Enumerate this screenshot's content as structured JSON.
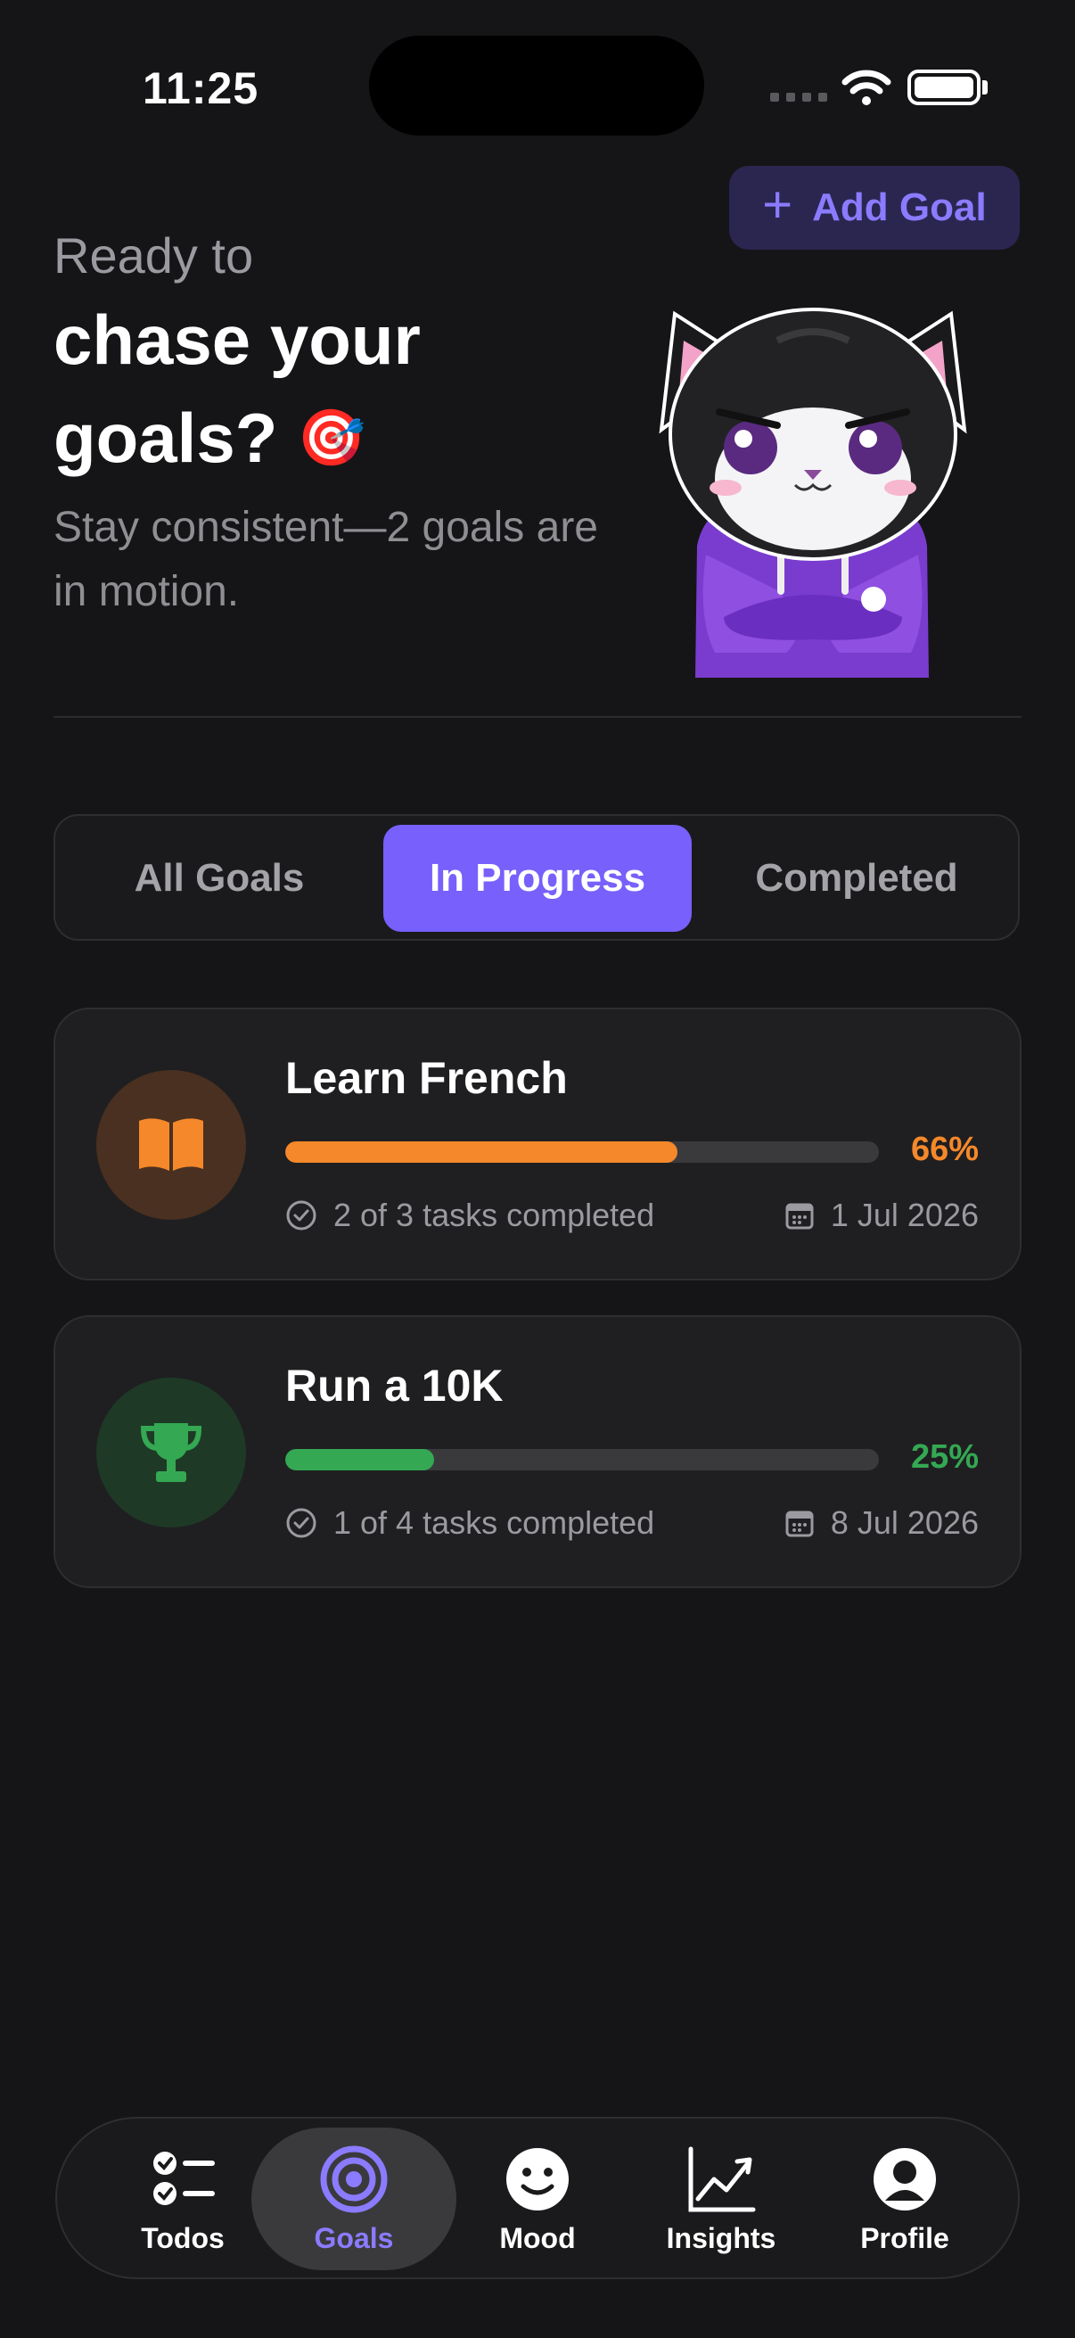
{
  "status_bar": {
    "time": "11:25"
  },
  "header": {
    "add_goal_label": "Add Goal",
    "greeting_line1": "Ready to",
    "greeting_line2": "chase your",
    "greeting_line3": "goals?",
    "greeting_emoji": "🎯",
    "subtitle": "Stay consistent—2 goals are in motion."
  },
  "filter_tabs": {
    "all": "All Goals",
    "in_progress": "In Progress",
    "completed": "Completed",
    "selected": "In Progress"
  },
  "goals": [
    {
      "title": "Learn French",
      "icon": "book-icon",
      "progress": 0.66,
      "percent_label": "66%",
      "tasks_label": "2 of 3 tasks completed",
      "due_date": "1 Jul 2026",
      "accent_color": "#f5882a",
      "icon_bg_color": "#4a3020"
    },
    {
      "title": "Run a 10K",
      "icon": "trophy-icon",
      "progress": 0.25,
      "percent_label": "25%",
      "tasks_label": "1 of 4 tasks completed",
      "due_date": "8 Jul 2026",
      "accent_color": "#34a853",
      "icon_bg_color": "#1e3a26"
    }
  ],
  "tab_bar": {
    "todos": "Todos",
    "goals": "Goals",
    "mood": "Mood",
    "insights": "Insights",
    "profile": "Profile",
    "active": "Goals"
  },
  "colors": {
    "accent": "#7760fb",
    "background": "#151517"
  }
}
